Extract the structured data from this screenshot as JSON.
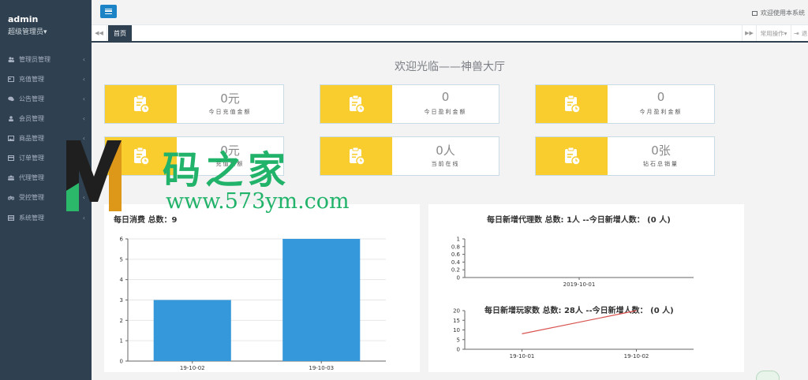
{
  "sidebar": {
    "username": "admin",
    "role": "超级管理员▾",
    "items": [
      {
        "label": "管理员管理",
        "icon": "users-icon"
      },
      {
        "label": "充值管理",
        "icon": "card-icon"
      },
      {
        "label": "公告管理",
        "icon": "comments-icon"
      },
      {
        "label": "会员管理",
        "icon": "user-icon"
      },
      {
        "label": "商品管理",
        "icon": "image-icon"
      },
      {
        "label": "订单管理",
        "icon": "credit-card-icon"
      },
      {
        "label": "代理管理",
        "icon": "group-icon"
      },
      {
        "label": "受控管理",
        "icon": "bicycle-icon"
      },
      {
        "label": "系统管理",
        "icon": "table-icon"
      }
    ]
  },
  "header": {
    "welcome": "欢迎使用本系统"
  },
  "tabs": {
    "home": "首页",
    "ops": "常用操作▾",
    "exit": "退"
  },
  "main": {
    "hall_title": "欢迎光临——神兽大厅",
    "stats": [
      {
        "value": "0元",
        "label": "今日充值金额"
      },
      {
        "value": "0",
        "label": "今日盈利金额"
      },
      {
        "value": "0",
        "label": "今月盈利金额"
      },
      {
        "value": "0元",
        "label": "充值金额"
      },
      {
        "value": "0人",
        "label": "当前在线"
      },
      {
        "value": "0张",
        "label": "钻石总销量"
      }
    ]
  },
  "watermark": {
    "text": "码之家",
    "url": "www.573ym.com"
  },
  "colors": {
    "sidebar_bg": "#2f4050",
    "accent": "#1c84c6",
    "card_yellow": "#f8cd2d",
    "bar_blue": "#3498db",
    "line_red": "#d9534f"
  },
  "chart_data": [
    {
      "type": "bar",
      "title": "每日消费 总数：9",
      "categories": [
        "19-10-02",
        "19-10-03"
      ],
      "values": [
        3,
        6
      ],
      "ylim": [
        0,
        6
      ],
      "yticks": [
        "0",
        "1",
        "2",
        "3",
        "4",
        "5",
        "6"
      ],
      "grid": true
    },
    {
      "type": "line",
      "title": "每日新增代理数 总数: 1人 --今日新增人数： (0 人)",
      "categories": [
        "2019-10-01"
      ],
      "values": [
        0
      ],
      "ylim": [
        0,
        1
      ],
      "yticks": [
        "0",
        "0.2",
        "0.4",
        "0.6",
        "0.8",
        "1"
      ]
    },
    {
      "type": "line",
      "title": "每日新增玩家数 总数: 28人 --今日新增人数： (0 人)",
      "categories": [
        "19-10-01",
        "19-10-02"
      ],
      "values": [
        8,
        20
      ],
      "ylim": [
        0,
        20
      ],
      "yticks": [
        "0",
        "5",
        "10",
        "15",
        "20"
      ]
    }
  ]
}
